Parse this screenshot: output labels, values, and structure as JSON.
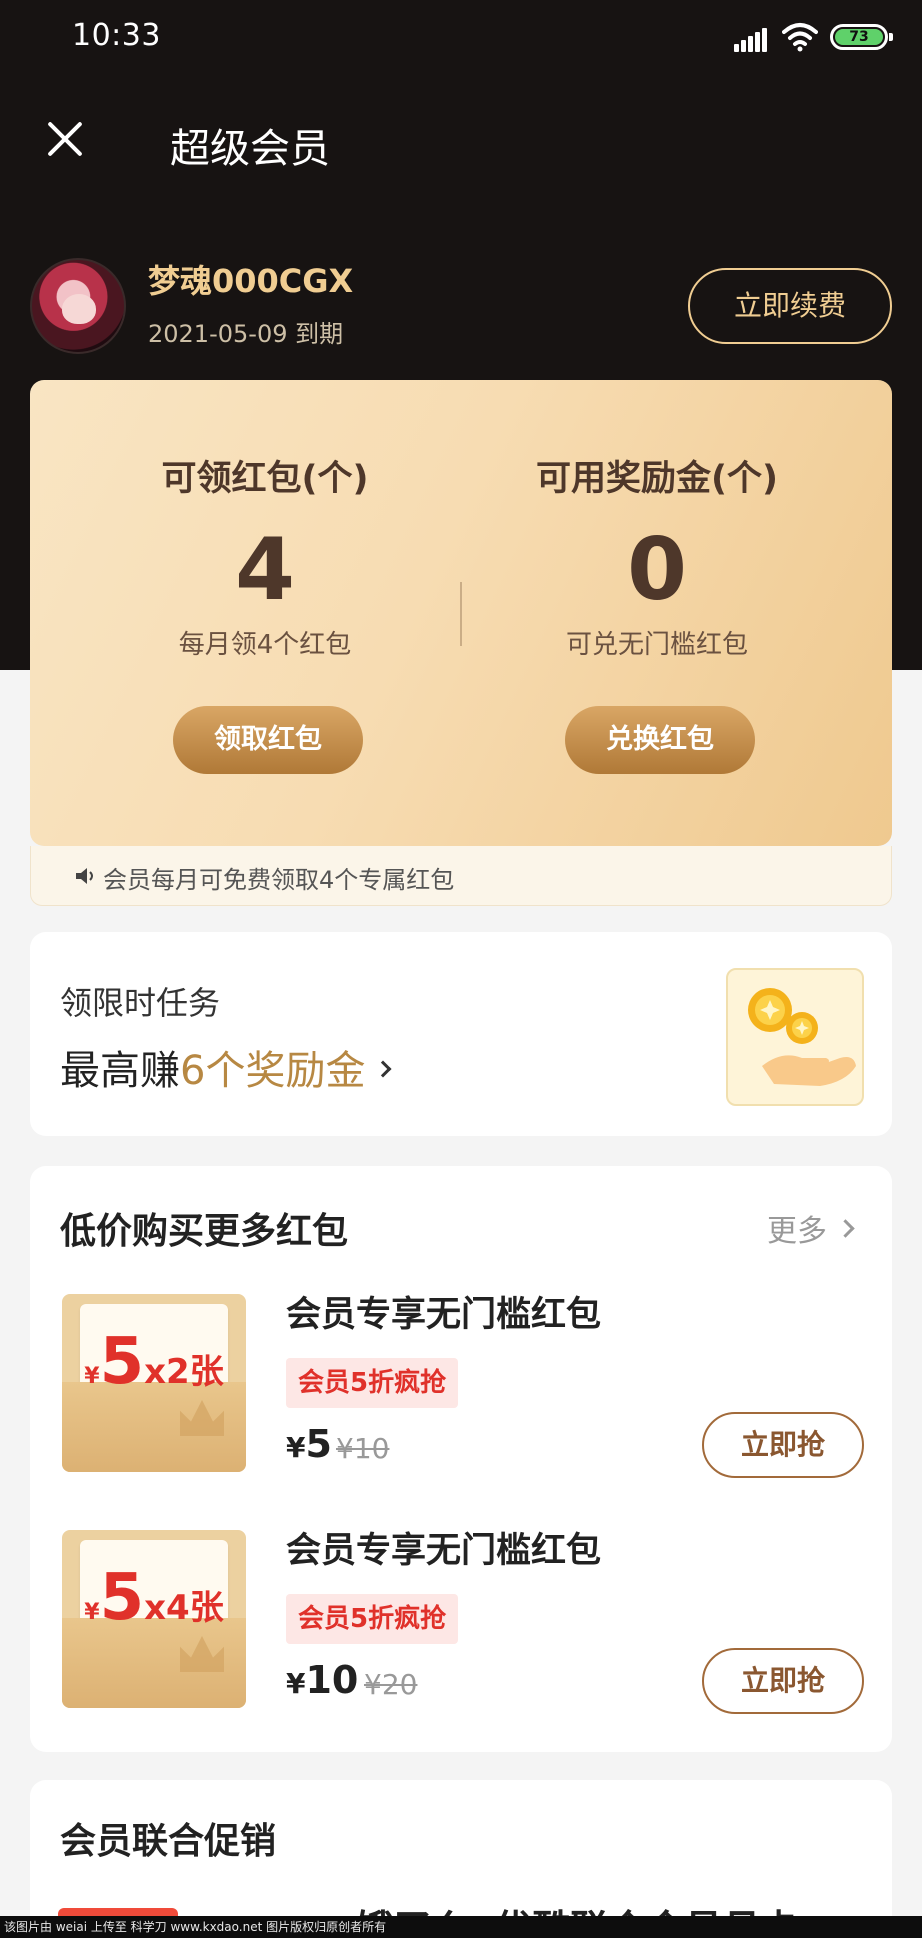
{
  "status_bar": {
    "time": "10:33",
    "battery": "73",
    "icons": [
      "signal-icon",
      "wifi-icon",
      "battery-icon"
    ]
  },
  "header": {
    "title": "超级会员",
    "close_icon": "close-icon"
  },
  "user": {
    "name": "梦魂000CGX",
    "expire": "2021-05-09 到期",
    "renew_label": "立即续费"
  },
  "benefits": {
    "red_packets": {
      "label": "可领红包(个)",
      "value": "4",
      "sub": "每月领4个红包",
      "button": "领取红包"
    },
    "bonus": {
      "label": "可用奖励金(个)",
      "value": "0",
      "sub": "可兑无门槛红包",
      "button": "兑换红包"
    },
    "notice": "会员每月可免费领取4个专属红包",
    "notice_icon": "speaker-icon"
  },
  "task": {
    "label": "领限时任务",
    "reward_prefix": "最高赚",
    "reward_highlight": "6个奖励金",
    "image_icon": "coins-hand-icon"
  },
  "buy_section": {
    "title": "低价购买更多红包",
    "more_label": "更多",
    "products": [
      {
        "name": "会员专享无门槛红包",
        "tag": "会员5折疯抢",
        "currency": "¥",
        "price": "5",
        "old_price": "¥10",
        "button": "立即抢",
        "envelope_yen": "¥",
        "envelope_amount": "5",
        "envelope_count": "x2张"
      },
      {
        "name": "会员专享无门槛红包",
        "tag": "会员5折疯抢",
        "currency": "¥",
        "price": "10",
        "old_price": "¥20",
        "button": "立即抢",
        "envelope_yen": "¥",
        "envelope_amount": "5",
        "envelope_count": "x4张"
      }
    ]
  },
  "promo": {
    "title": "会员联合促销",
    "item_text": "饿了么x优酷联合会员月卡"
  },
  "watermark": "该图片由 weiai 上传至 科学刀 www.kxdao.net 图片版权归原创者所有",
  "colors": {
    "dark_bg": "#171312",
    "gold_text": "#f0cd92",
    "accent_brown": "#b78843",
    "red": "#e0312a"
  }
}
